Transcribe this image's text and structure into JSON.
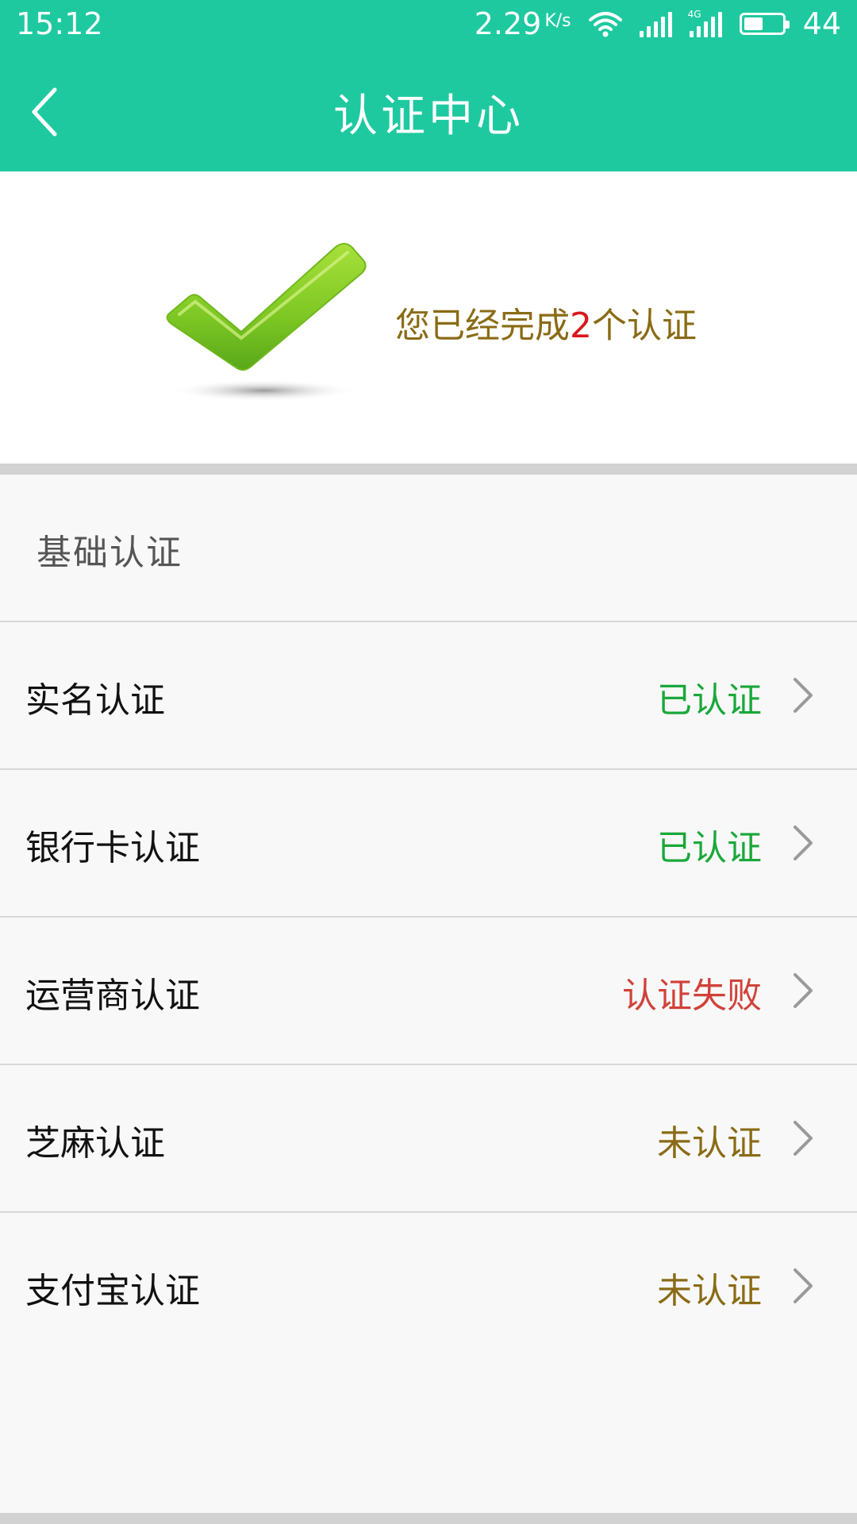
{
  "status_bar": {
    "time": "15:12",
    "speed": "2.29",
    "speed_unit": "K/s",
    "network_label": "4G",
    "battery": "44",
    "icons": [
      "wifi-icon",
      "signal-icon",
      "4g-signal-icon",
      "battery-icon"
    ]
  },
  "header": {
    "title": "认证中心",
    "back_icon": "back-arrow-icon"
  },
  "summary": {
    "icon": "checkmark-icon",
    "text_prefix": "您已经完成",
    "count": "2",
    "text_suffix": "个认证"
  },
  "section": {
    "title": "基础认证"
  },
  "items": [
    {
      "label": "实名认证",
      "status": "已认证",
      "status_color": "#1aa83a"
    },
    {
      "label": "银行卡认证",
      "status": "已认证",
      "status_color": "#1aa83a"
    },
    {
      "label": "运营商认证",
      "status": "认证失败",
      "status_color": "#d0423a"
    },
    {
      "label": "芝麻认证",
      "status": "未认证",
      "status_color": "#8a6b15"
    },
    {
      "label": "支付宝认证",
      "status": "未认证",
      "status_color": "#8a6b15"
    }
  ],
  "colors": {
    "brand": "#1ec9a0",
    "summary_text": "#8a6b15",
    "summary_count": "#d9171d"
  }
}
